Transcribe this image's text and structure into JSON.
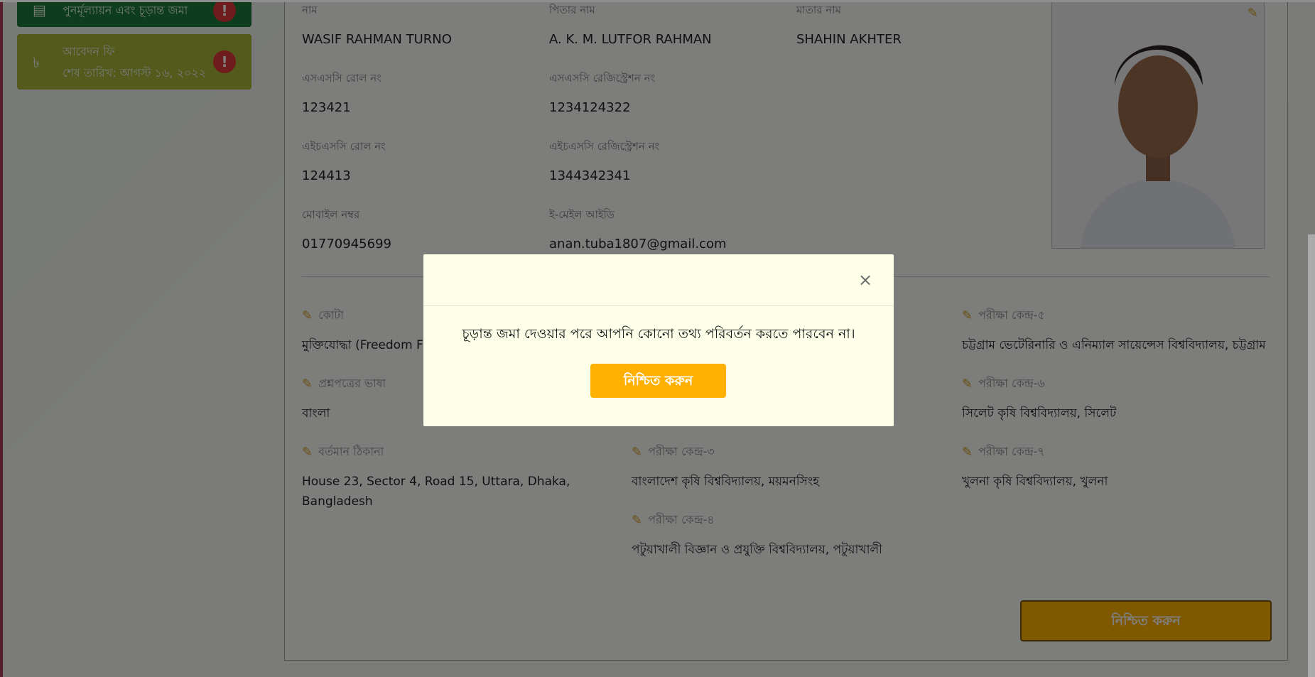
{
  "sidebar": {
    "card1_text": "পুনর্মূল্যায়ন এবং চূড়ান্ত জমা",
    "card2_title": "আবেদন ফি",
    "card2_deadline": "শেষ তারিখ: আগস্ট ১৬, ২০২২"
  },
  "profile": {
    "name_label": "নাম",
    "name_value": "WASIF RAHMAN TURNO",
    "father_label": "পিতার নাম",
    "father_value": "A. K. M. LUTFOR RAHMAN",
    "mother_label": "মাতার নাম",
    "mother_value": "SHAHIN AKHTER",
    "ssc_roll_label": "এসএসসি রোল নং",
    "ssc_roll_value": "123421",
    "ssc_reg_label": "এসএসসি রেজিস্ট্রেশন নং",
    "ssc_reg_value": "1234124322",
    "hsc_roll_label": "এইচএসসি রোল নং",
    "hsc_roll_value": "124413",
    "hsc_reg_label": "এইচএসসি রেজিস্ট্রেশন নং",
    "hsc_reg_value": "1344342341",
    "mobile_label": "মোবাইল নম্বর",
    "mobile_value": "01770945699",
    "email_label": "ই-মেইল আইডি",
    "email_value": "anan.tuba1807@gmail.com"
  },
  "details": {
    "quota_label": "কোটা",
    "quota_value": "মুক্তিযোদ্ধা (Freedom Fig",
    "language_label": "প্রশ্নপত্রের ভাষা",
    "language_value": "বাংলা",
    "address_label": "বর্তমান ঠিকানা",
    "address_value": "House 23, Sector 4, Road 15, Uttara, Dhaka, Bangladesh",
    "center3_label": "পরীক্ষা কেন্দ্র-৩",
    "center3_value": "বাংলাদেশ কৃষি বিশ্ববিদ্যালয়, ময়মনসিংহ",
    "center4_label": "পরীক্ষা কেন্দ্র-৪",
    "center4_value": "পটুয়াখালী বিজ্ঞান ও প্রযুক্তি বিশ্ববিদ্যালয়, পটুয়াখালী",
    "center5_label": "পরীক্ষা কেন্দ্র-৫",
    "center5_value": "চট্টগ্রাম ভেটেরিনারি ও এনিম্যাল সায়েন্সেস বিশ্ববিদ্যালয়, চট্টগ্রাম",
    "center6_label": "পরীক্ষা কেন্দ্র-৬",
    "center6_value": "সিলেট কৃষি বিশ্ববিদ্যালয়, সিলেট",
    "center7_label": "পরীক্ষা কেন্দ্র-৭",
    "center7_value": "খুলনা কৃষি বিশ্ববিদ্যালয়, খুলনা"
  },
  "page_confirm_label": "নিশ্চিত করুন",
  "modal": {
    "message": "চূড়ান্ত জমা দেওয়ার পরে আপনি কোনো তথ্য পরিবর্তন করতে পারবেন না।",
    "confirm_label": "নিশ্চিত করুন",
    "close_symbol": "×"
  }
}
